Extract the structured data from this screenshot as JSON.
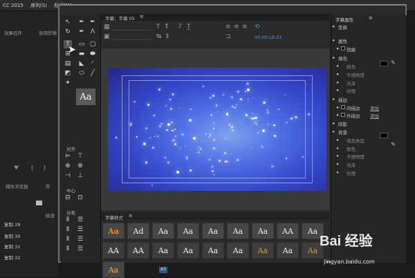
{
  "host": {
    "menu": [
      "CC 2015",
      "序列(S)",
      "标记(M)"
    ],
    "left_panel": {
      "tab_effects": "效果控件",
      "tab_audio": "音频剪辑",
      "bin_tab": "媒体浏览器",
      "bin_label": "库",
      "resolution": "帧速",
      "items": [
        "复制 28",
        "复制 30",
        "复制 31",
        "复制 32"
      ]
    }
  },
  "titler": {
    "panel_title": "字幕：字幕 05",
    "timecode": "00:00:18:22",
    "tools_section_labels": {
      "align": "对齐",
      "center": "中心",
      "distribute": "分布"
    },
    "sample_text": "Aa",
    "styles_title": "字幕样式",
    "style_samples": [
      "Aa",
      "Ad",
      "Aa",
      "Aa",
      "Aa",
      "Aa",
      "Aa",
      "AA",
      "Aa",
      "AA",
      "AA",
      "Aa",
      "Aa",
      "Aa",
      "Aa",
      "Aa",
      "Aa",
      "Aa",
      "Aa"
    ],
    "properties": {
      "title": "字幕属性",
      "rows": [
        {
          "label": "变换",
          "level": 0
        },
        {
          "label": "属性",
          "level": 0
        },
        {
          "label": "扭曲",
          "level": 1
        },
        {
          "label": "填充",
          "level": 0
        },
        {
          "label": "颜色",
          "level": 1,
          "dim": true
        },
        {
          "label": "不透明度",
          "level": 1,
          "dim": true
        },
        {
          "label": "光泽",
          "level": 1,
          "dim": true
        },
        {
          "label": "纹理",
          "level": 1,
          "dim": true
        },
        {
          "label": "描边",
          "level": 0
        },
        {
          "label": "内描边",
          "level": 1,
          "action": "添加"
        },
        {
          "label": "外描边",
          "level": 1,
          "action": "添加"
        },
        {
          "label": "阴影",
          "level": 0
        },
        {
          "label": "背景",
          "level": 0
        },
        {
          "label": "填充类型",
          "level": 1,
          "dim": true
        },
        {
          "label": "颜色",
          "level": 1,
          "dim": true
        },
        {
          "label": "不透明度",
          "level": 1,
          "dim": true
        },
        {
          "label": "光泽",
          "level": 1,
          "dim": true
        },
        {
          "label": "纹理",
          "level": 1,
          "dim": true
        }
      ]
    }
  },
  "watermark": {
    "brand": "Bai 经验",
    "url": "jingyan.baidu.com"
  },
  "colors": {
    "accent": "#3ea2e5",
    "canvas_center": "#7ea2ee",
    "canvas_edge": "#26268a"
  }
}
